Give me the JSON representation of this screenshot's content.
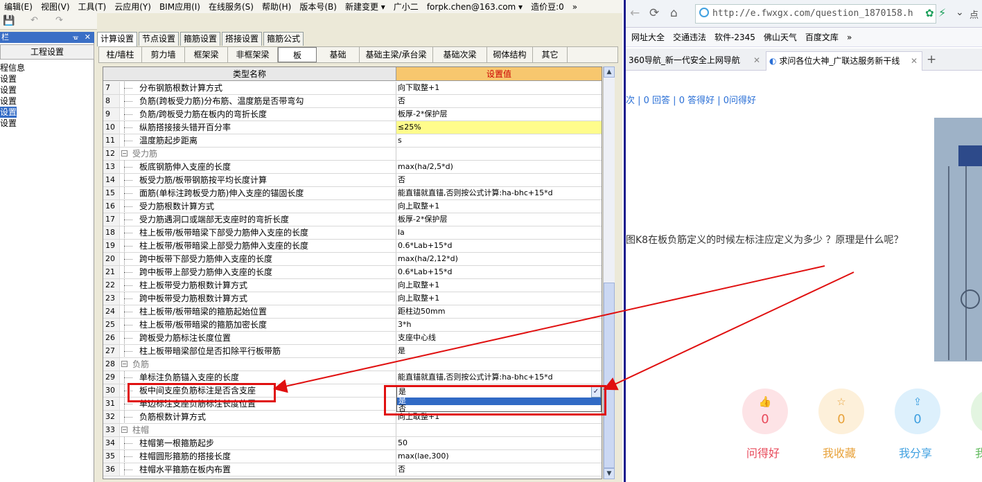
{
  "menu": [
    "编辑(E)",
    "视图(V)",
    "工具(T)",
    "云应用(Y)",
    "BIM应用(I)",
    "在线服务(S)",
    "帮助(H)",
    "版本号(B)",
    "新建变更 ▾",
    "广小二",
    "forpk.chen@163.com ▾",
    "造价豆:0",
    "»"
  ],
  "left_panel": {
    "title": "栏",
    "pin": "ᚗ",
    "close": "✕",
    "header": "工程设置",
    "items": [
      "程信息",
      "设置",
      "设置",
      "设置",
      "设置",
      "设置"
    ],
    "selected_index": 4
  },
  "tabs": [
    "计算设置",
    "节点设置",
    "箍筋设置",
    "搭接设置",
    "箍筋公式"
  ],
  "active_tab": 0,
  "subtabs": [
    "柱/墙柱",
    "剪力墙",
    "框架梁",
    "非框架梁",
    "板",
    "基础",
    "基础主梁/承台梁",
    "基础次梁",
    "砌体结构",
    "其它"
  ],
  "active_subtab": 4,
  "grid": {
    "header_name": "类型名称",
    "header_value": "设置值",
    "rows": [
      {
        "n": "7",
        "name": "分布钢筋根数计算方式",
        "val": "向下取整+1"
      },
      {
        "n": "8",
        "name": "负筋(跨板受力筋)分布筋、温度筋是否带弯勾",
        "val": "否"
      },
      {
        "n": "9",
        "name": "负筋/跨板受力筋在板内的弯折长度",
        "val": "板厚-2*保护层"
      },
      {
        "n": "10",
        "name": "纵筋搭接接头错开百分率",
        "val": "≤25%",
        "yellow": true
      },
      {
        "n": "11",
        "name": "温度筋起步距离",
        "val": "s"
      },
      {
        "n": "12",
        "name": "受力筋",
        "val": "",
        "cat": true
      },
      {
        "n": "13",
        "name": "板底钢筋伸入支座的长度",
        "val": "max(ha/2,5*d)"
      },
      {
        "n": "14",
        "name": "板受力筋/板带钢筋按平均长度计算",
        "val": "否"
      },
      {
        "n": "15",
        "name": "面筋(单标注跨板受力筋)伸入支座的锚固长度",
        "val": "能直锚就直锚,否则按公式计算:ha-bhc+15*d"
      },
      {
        "n": "16",
        "name": "受力筋根数计算方式",
        "val": "向上取整+1"
      },
      {
        "n": "17",
        "name": "受力筋遇洞口或端部无支座时的弯折长度",
        "val": "板厚-2*保护层"
      },
      {
        "n": "18",
        "name": "柱上板带/板带暗梁下部受力筋伸入支座的长度",
        "val": "la"
      },
      {
        "n": "19",
        "name": "柱上板带/板带暗梁上部受力筋伸入支座的长度",
        "val": "0.6*Lab+15*d"
      },
      {
        "n": "20",
        "name": "跨中板带下部受力筋伸入支座的长度",
        "val": "max(ha/2,12*d)"
      },
      {
        "n": "21",
        "name": "跨中板带上部受力筋伸入支座的长度",
        "val": "0.6*Lab+15*d"
      },
      {
        "n": "22",
        "name": "柱上板带受力筋根数计算方式",
        "val": "向上取整+1"
      },
      {
        "n": "23",
        "name": "跨中板带受力筋根数计算方式",
        "val": "向上取整+1"
      },
      {
        "n": "24",
        "name": "柱上板带/板带暗梁的箍筋起始位置",
        "val": "距柱边50mm"
      },
      {
        "n": "25",
        "name": "柱上板带/板带暗梁的箍筋加密长度",
        "val": "3*h"
      },
      {
        "n": "26",
        "name": "跨板受力筋标注长度位置",
        "val": "支座中心线"
      },
      {
        "n": "27",
        "name": "柱上板带暗梁部位是否扣除平行板带筋",
        "val": "是"
      },
      {
        "n": "28",
        "name": "负筋",
        "val": "",
        "cat": true
      },
      {
        "n": "29",
        "name": "单标注负筋锚入支座的长度",
        "val": "能直锚就直锚,否则按公式计算:ha-bhc+15*d"
      },
      {
        "n": "30",
        "name": "板中间支座负筋标注是否含支座",
        "val": "是",
        "sel": true
      },
      {
        "n": "31",
        "name": "单边标注支座负筋标注长度位置",
        "val": ""
      },
      {
        "n": "32",
        "name": "负筋根数计算方式",
        "val": "向上取整+1"
      },
      {
        "n": "33",
        "name": "柱帽",
        "val": "",
        "cat": true
      },
      {
        "n": "34",
        "name": "柱帽第一根箍筋起步",
        "val": "50"
      },
      {
        "n": "35",
        "name": "柱帽圆形箍筋的搭接长度",
        "val": "max(lae,300)"
      },
      {
        "n": "36",
        "name": "柱帽水平箍筋在板内布置",
        "val": "否"
      }
    ]
  },
  "dropdown": {
    "selected": "是",
    "options": [
      "是",
      "否"
    ],
    "button": "✓"
  },
  "scroll": {
    "up": "▲",
    "down": "▼"
  },
  "browser": {
    "url": "http://e.fwxgx.com/question_1870158.h",
    "bookmarks": [
      "网址大全",
      "交通违法",
      "软件-2345",
      "佛山天气",
      "百度文库",
      "»"
    ],
    "tabs": [
      {
        "label": "360导航_新一代安全上网导航",
        "close": "✕"
      },
      {
        "label": "求问各位大神_广联达服务新干线",
        "close": "✕"
      }
    ],
    "new_tab": "+",
    "stats": "次 | 0 回答 | 0 答得好 | 0问得好",
    "question": "图K8在板负筋定义的时候左标注应定义为多少 ？原理是什么呢？",
    "actions": [
      {
        "count": "0",
        "label": "问得好",
        "icon": "👍"
      },
      {
        "count": "0",
        "label": "我收藏",
        "icon": "☆"
      },
      {
        "count": "0",
        "label": "我分享",
        "icon": "⇪"
      },
      {
        "count": "",
        "label": "我",
        "icon": ""
      }
    ],
    "colors": {
      "red": "#e8495a",
      "orange": "#e8a23a",
      "blue": "#3fa0e0",
      "green": "#5db85a"
    }
  }
}
